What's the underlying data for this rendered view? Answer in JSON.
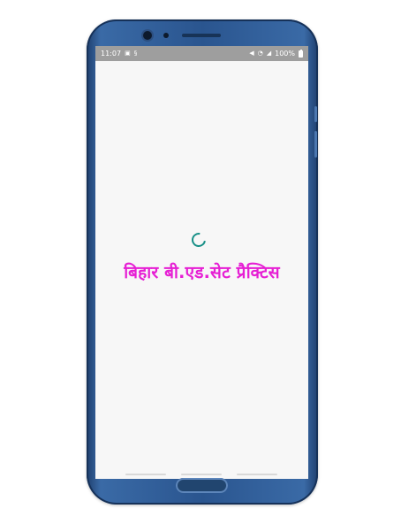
{
  "status_bar": {
    "time": "11:07",
    "left_icons": [
      "image-icon",
      "notification-icon"
    ],
    "right_icons": [
      "mute-icon",
      "wifi-icon",
      "signal-icon"
    ],
    "battery_text": "100%",
    "battery_icon": "battery-icon"
  },
  "splash": {
    "title": "बिहार बी.एड.सेट प्रैक्टिस",
    "title_color": "#e61fd4",
    "spinner_color": "#168f86"
  },
  "device": {
    "frame_color": "#2a558f",
    "screen_background": "#f7f7f7"
  }
}
